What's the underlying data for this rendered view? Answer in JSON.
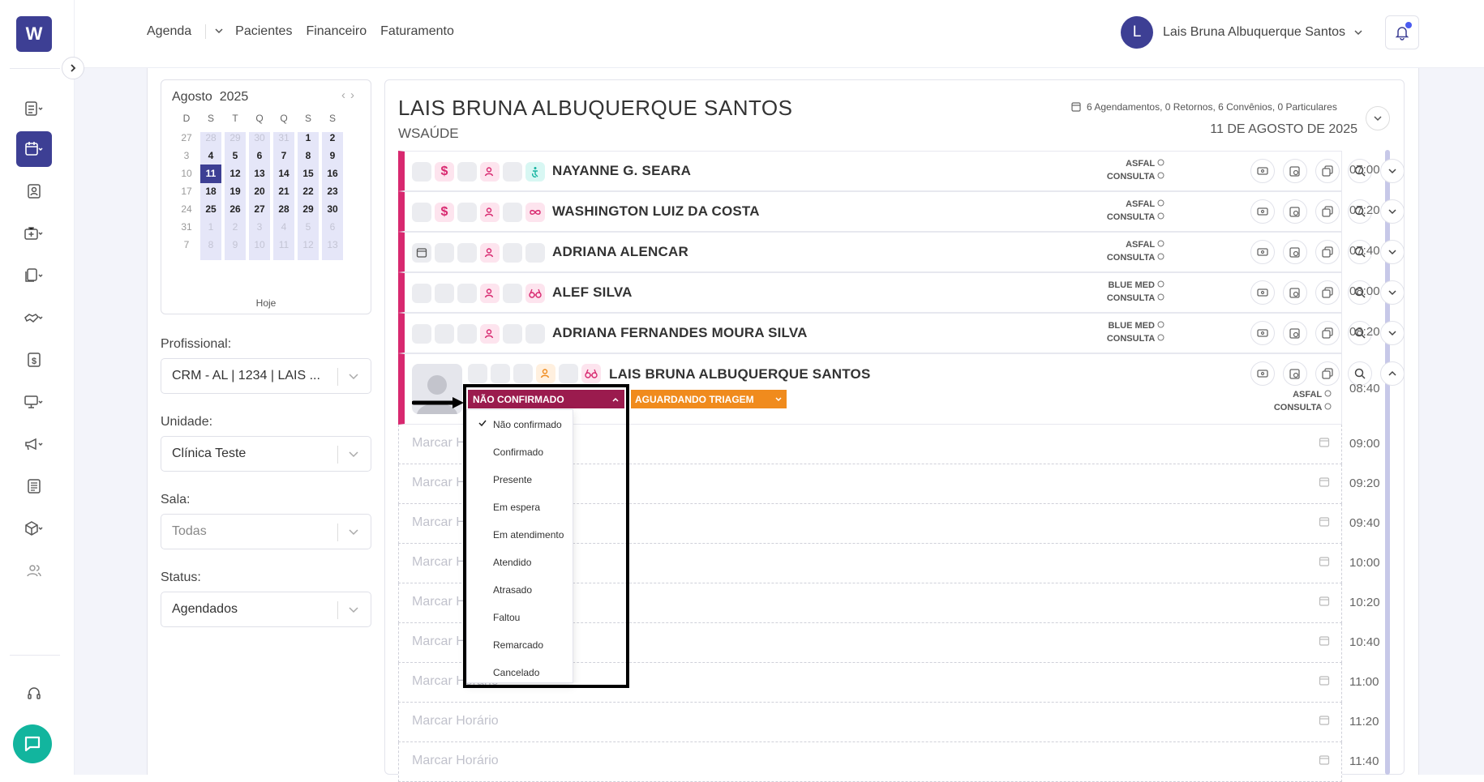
{
  "app": {
    "logo_letter": "W"
  },
  "topnav": {
    "items": [
      "Agenda",
      "Pacientes",
      "Financeiro",
      "Faturamento"
    ]
  },
  "user": {
    "initial": "L",
    "name": "Lais Bruna Albuquerque Santos"
  },
  "sidebar": {
    "icons": [
      "agenda-list-icon",
      "calendar-icon",
      "patient-card-icon",
      "medical-bag-icon",
      "documents-icon",
      "handshake-icon",
      "finance-icon",
      "monitor-icon",
      "megaphone-icon",
      "report-icon",
      "box-icon",
      "users-icon",
      "headset-icon"
    ]
  },
  "calendar": {
    "month_label": "Agosto",
    "year_label": "2025",
    "weekdays": [
      "D",
      "S",
      "T",
      "Q",
      "Q",
      "S",
      "S"
    ],
    "weeks": [
      [
        "27",
        "28",
        "29",
        "30",
        "31",
        "1",
        "2"
      ],
      [
        "3",
        "4",
        "5",
        "6",
        "7",
        "8",
        "9"
      ],
      [
        "10",
        "11",
        "12",
        "13",
        "14",
        "15",
        "16"
      ],
      [
        "17",
        "18",
        "19",
        "20",
        "21",
        "22",
        "23"
      ],
      [
        "24",
        "25",
        "26",
        "27",
        "28",
        "29",
        "30"
      ],
      [
        "31",
        "1",
        "2",
        "3",
        "4",
        "5",
        "6"
      ],
      [
        "7",
        "8",
        "9",
        "10",
        "11",
        "12",
        "13"
      ]
    ],
    "today_label": "Hoje",
    "selected_day": "11"
  },
  "filters": {
    "professional": {
      "label": "Profissional:",
      "value": "CRM - AL | 1234 | LAIS ..."
    },
    "unit": {
      "label": "Unidade:",
      "value": "Clínica Teste"
    },
    "room": {
      "label": "Sala:",
      "value": "Todas"
    },
    "status": {
      "label": "Status:",
      "value": "Agendados"
    }
  },
  "schedule": {
    "professional_name": "LAIS BRUNA ALBUQUERQUE SANTOS",
    "clinic": "WSAÚDE",
    "summary": "6 Agendamentos, 0 Retornos, 6 Convênios, 0 Particulares",
    "date": "11 DE AGOSTO DE 2025",
    "appointments": [
      {
        "time": "07:00",
        "name": "NAYANNE G. SEARA",
        "insurance": "ASFAL",
        "type": "CONSULTA"
      },
      {
        "time": "07:20",
        "name": "WASHINGTON LUIZ DA COSTA",
        "insurance": "ASFAL",
        "type": "CONSULTA"
      },
      {
        "time": "07:40",
        "name": "ADRIANA ALENCAR",
        "insurance": "ASFAL",
        "type": "CONSULTA"
      },
      {
        "time": "08:00",
        "name": "ALEF SILVA",
        "insurance": "BLUE MED",
        "type": "CONSULTA"
      },
      {
        "time": "08:20",
        "name": "ADRIANA FERNANDES MOURA SILVA",
        "insurance": "BLUE MED",
        "type": "CONSULTA"
      },
      {
        "time": "08:40",
        "name": "LAIS BRUNA ALBUQUERQUE SANTOS",
        "insurance": "ASFAL",
        "type": "CONSULTA"
      }
    ],
    "empty_label": "Marcar Horário",
    "empty_slots": [
      "09:00",
      "09:20",
      "09:40",
      "10:00",
      "10:20",
      "10:40",
      "11:00",
      "11:20",
      "11:40"
    ]
  },
  "status_dropdown": {
    "current": "NÃO CONFIRMADO",
    "triage": "AGUARDANDO TRIAGEM",
    "options": [
      "Não confirmado",
      "Confirmado",
      "Presente",
      "Em espera",
      "Em atendimento",
      "Atendido",
      "Atrasado",
      "Faltou",
      "Remarcado",
      "Cancelado"
    ],
    "selected": "Não confirmado"
  },
  "colors": {
    "brand": "#3d3f94",
    "status_bar": "#d8286f",
    "not_confirmed": "#9b1b4e",
    "triage": "#f08b1d",
    "chat": "#12b59e"
  }
}
